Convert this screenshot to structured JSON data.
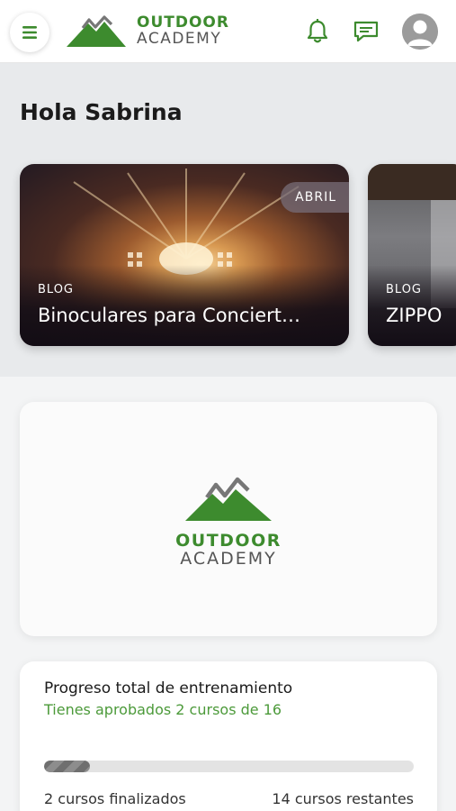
{
  "header": {
    "brand_line1": "OUTDOOR",
    "brand_line2": "ACADEMY",
    "menu_icon": "hamburger-icon",
    "notifications_icon": "bell-icon",
    "messages_icon": "chat-icon",
    "avatar_icon": "user-avatar-icon",
    "accent_color": "#3d8b2e"
  },
  "greeting": "Hola Sabrina",
  "cards": [
    {
      "category": "BLOG",
      "title": "Binoculares para Conciert…",
      "badge": "ABRIL"
    },
    {
      "category": "BLOG",
      "title": "ZIPPO"
    }
  ],
  "logo_card": {
    "brand_line1": "OUTDOOR",
    "brand_line2": "ACADEMY"
  },
  "progress": {
    "title": "Progreso total de entrenamiento",
    "subtitle": "Tienes aprobados 2 cursos de 16",
    "completed_fraction": 0.125,
    "finished_label": "2 cursos finalizados",
    "remaining_label": "14 cursos restantes"
  }
}
